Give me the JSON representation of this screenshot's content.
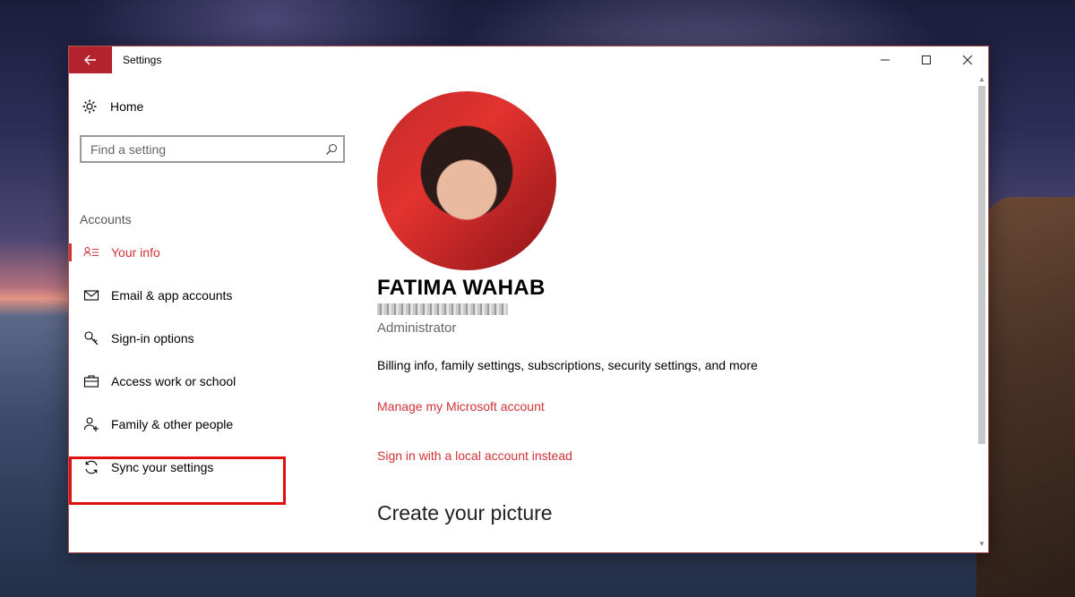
{
  "window": {
    "title": "Settings",
    "accent_color": "#d13438",
    "caption": {
      "minimize_icon": "minimize-icon",
      "maximize_icon": "maximize-icon",
      "close_icon": "close-icon"
    }
  },
  "sidebar": {
    "home_label": "Home",
    "search_placeholder": "Find a setting",
    "section_label": "Accounts",
    "items": [
      {
        "label": "Your info",
        "icon": "contact-card-icon",
        "active": true
      },
      {
        "label": "Email & app accounts",
        "icon": "mail-icon",
        "active": false
      },
      {
        "label": "Sign-in options",
        "icon": "key-icon",
        "active": false
      },
      {
        "label": "Access work or school",
        "icon": "briefcase-icon",
        "active": false
      },
      {
        "label": "Family & other people",
        "icon": "add-person-icon",
        "active": false
      },
      {
        "label": "Sync your settings",
        "icon": "sync-icon",
        "active": false
      }
    ]
  },
  "profile": {
    "name": "FATIMA WAHAB",
    "role": "Administrator",
    "billing_text": "Billing info, family settings, subscriptions, security settings, and more",
    "manage_link": "Manage my Microsoft account",
    "local_account_link": "Sign in with a local account instead",
    "create_picture_title": "Create your picture"
  }
}
